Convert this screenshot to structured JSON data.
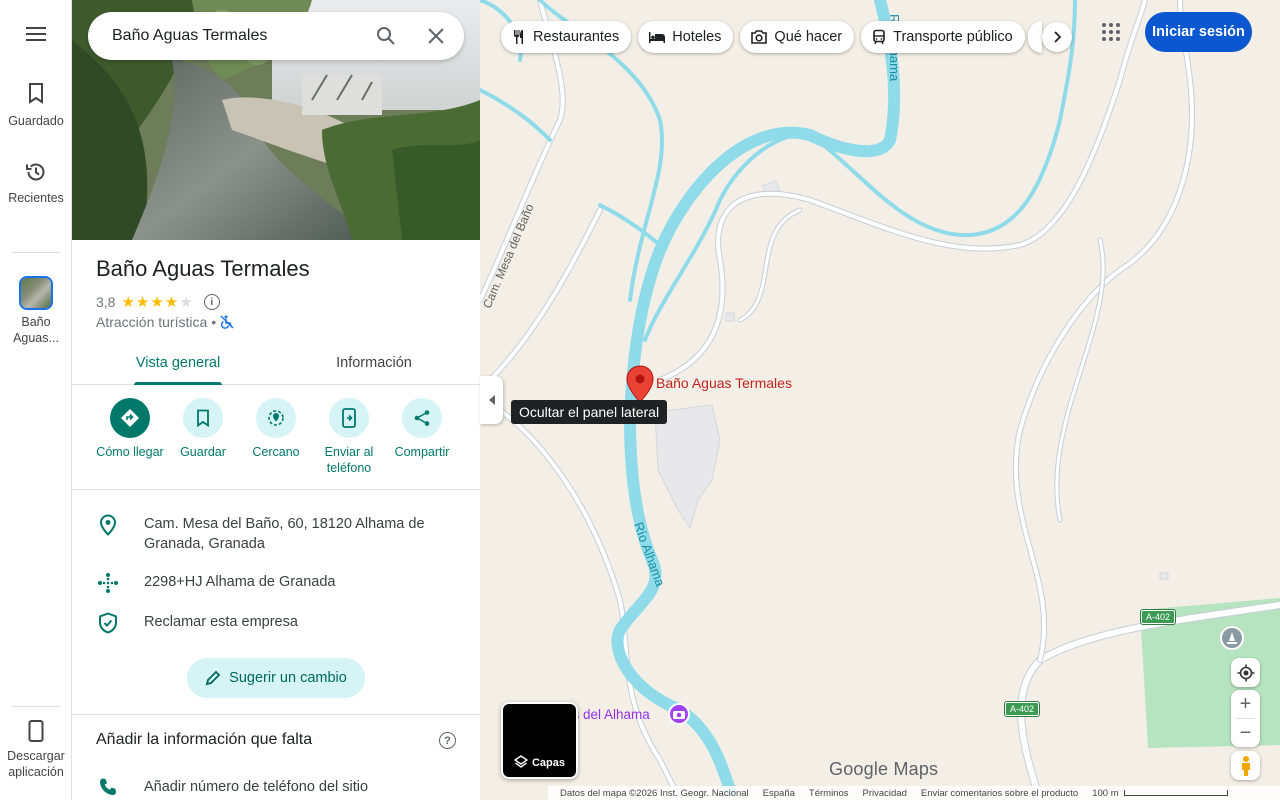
{
  "rail": {
    "menu_icon": "hamburger-icon",
    "saved_label": "Guardado",
    "recent_label": "Recientes",
    "place_label": "Baño Aguas...",
    "download_label": "Descargar aplicación"
  },
  "search": {
    "value": "Baño Aguas Termales",
    "search_icon": "search-icon",
    "close_icon": "close-icon"
  },
  "place": {
    "title": "Baño Aguas Termales",
    "rating": "3,8",
    "stars": 3.8,
    "category": "Atracción turística",
    "separator": "•",
    "no_wheelchair_icon": "accessibility-off-icon"
  },
  "tabs": [
    {
      "label": "Vista general",
      "active": true
    },
    {
      "label": "Información",
      "active": false
    }
  ],
  "actions": [
    {
      "label": "Cómo llegar",
      "icon": "directions-icon"
    },
    {
      "label": "Guardar",
      "icon": "bookmark-icon"
    },
    {
      "label": "Cercano",
      "icon": "nearby-icon"
    },
    {
      "label": "Enviar al teléfono",
      "icon": "send-to-phone-icon"
    },
    {
      "label": "Compartir",
      "icon": "share-icon"
    }
  ],
  "details": {
    "address": "Cam. Mesa del Baño, 60, 18120 Alhama de Granada, Granada",
    "plus_code": "2298+HJ Alhama de Granada",
    "claim": "Reclamar esta empresa",
    "suggest_button": "Sugerir un cambio"
  },
  "missing_info": {
    "title": "Añadir la información que falta",
    "add_phone": "Añadir número de teléfono del sitio"
  },
  "tooltip": "Ocultar el panel lateral",
  "chips": [
    {
      "label": "Restaurantes",
      "icon": "restaurant-icon"
    },
    {
      "label": "Hoteles",
      "icon": "hotel-icon"
    },
    {
      "label": "Qué hacer",
      "icon": "camera-icon"
    },
    {
      "label": "Transporte público",
      "icon": "transit-icon"
    }
  ],
  "header": {
    "apps_icon": "apps-grid-icon",
    "signin": "Iniciar sesión"
  },
  "map": {
    "marker_label": "Baño Aguas Termales",
    "river_label": "Río Alhama",
    "river_label_top": "Río Alhama",
    "road_label": "Cam. Mesa del Baño",
    "poi_label": "Baños del Alhama",
    "poi_label_visible": "os del Alhama",
    "road_shield_1": "A-402",
    "road_shield_2": "A-402",
    "colors": {
      "land": "#f3efe6",
      "water": "#8fdbe9",
      "road": "#ffffff",
      "road_outline": "#c6ced6",
      "park": "#b7e4c0",
      "marker": "#ea4335"
    }
  },
  "map_controls": {
    "layers_label": "Capas",
    "locate_icon": "my-location-icon",
    "zoom_in": "+",
    "zoom_out": "−",
    "pegman_icon": "pegman-icon",
    "street_view_icon": "street-view-icon"
  },
  "branding": {
    "logo": "Google Maps"
  },
  "footer": {
    "attribution": "Datos del mapa ©2026 Inst. Geogr. Nacional",
    "country": "España",
    "terms": "Términos",
    "privacy": "Privacidad",
    "feedback": "Enviar comentarios sobre el producto",
    "scale": "100 m"
  }
}
